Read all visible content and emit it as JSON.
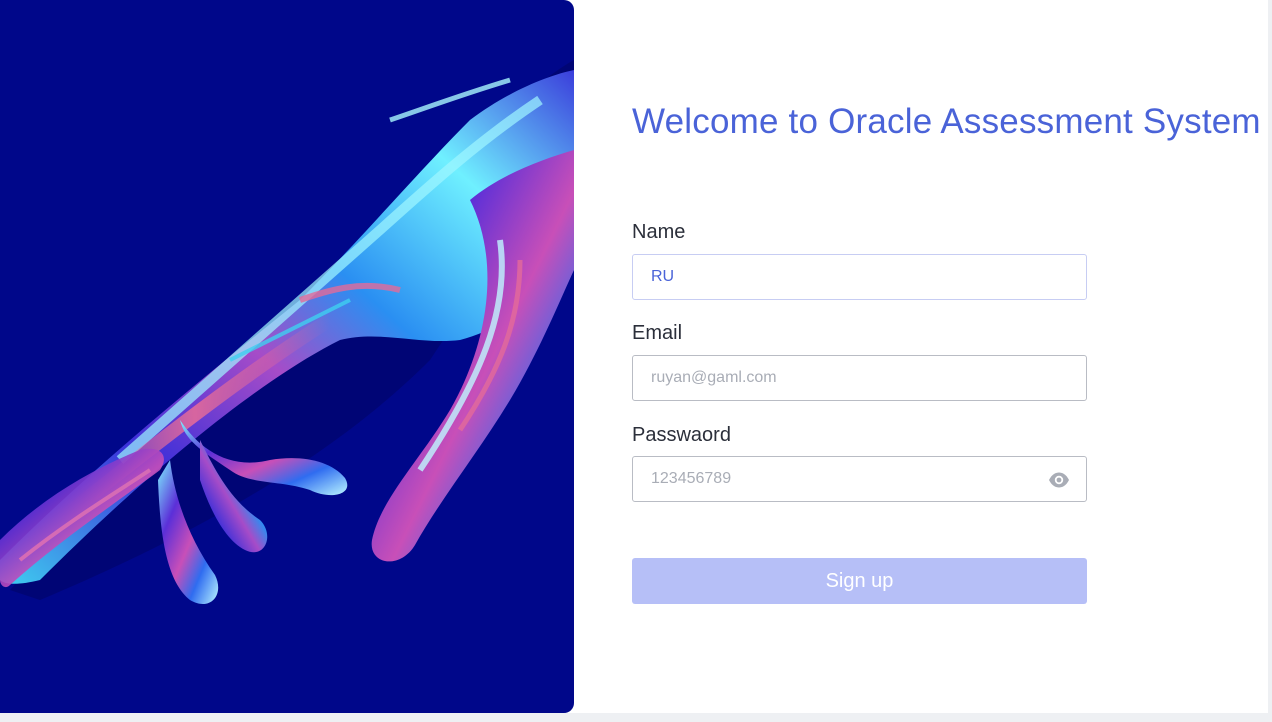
{
  "page": {
    "title": "Welcome to Oracle Assessment System"
  },
  "form": {
    "name": {
      "label": "Name",
      "value": "RU",
      "placeholder": ""
    },
    "email": {
      "label": "Email",
      "value": "",
      "placeholder": "ruyan@gaml.com"
    },
    "password": {
      "label": "Passwaord",
      "value": "",
      "placeholder": "123456789",
      "toggle_icon": "eye-icon"
    },
    "submit_label": "Sign up"
  },
  "colors": {
    "hero_background": "#00078a",
    "title": "#4a63d8",
    "button_disabled": "#b6bff7"
  },
  "hero": {
    "image": "iridescent-hand-illustration"
  }
}
